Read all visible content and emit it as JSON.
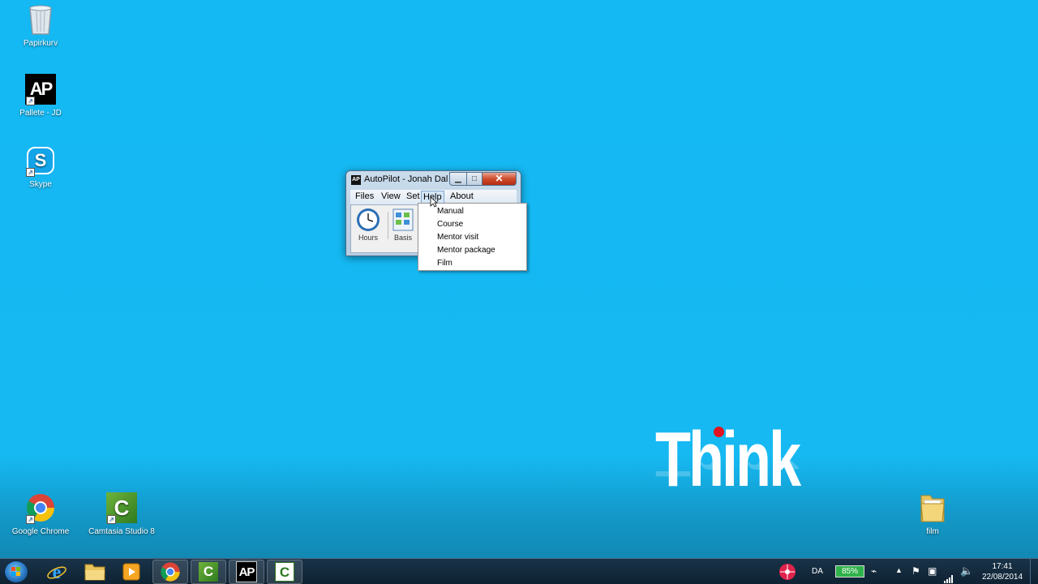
{
  "desktop": {
    "icons": [
      {
        "label": "Papirkurv"
      },
      {
        "label": "Pallete - JD"
      },
      {
        "label": "Skype"
      },
      {
        "label": "Google Chrome"
      },
      {
        "label": "Camtasia Studio 8"
      },
      {
        "label": "film"
      }
    ],
    "wallpaper_text": "Think"
  },
  "window": {
    "logo_text": "AP",
    "title": "AutoPilot - Jonah Dal...",
    "menu": [
      "Files",
      "View",
      "Set",
      "Help",
      "About"
    ],
    "active_menu": "Help",
    "tools": [
      {
        "label": "Hours",
        "icon": "clock-icon"
      },
      {
        "label": "Basis",
        "icon": "grid-icon"
      }
    ]
  },
  "help_menu": {
    "items": [
      "Manual",
      "Course",
      "Mentor visit",
      "Mentor package",
      "Film"
    ]
  },
  "taskbar": {
    "apps": [
      "start",
      "internet-explorer",
      "explorer",
      "media-player",
      "chrome",
      "camtasia",
      "autopilot",
      "camtasia-recorder"
    ],
    "language": "DA",
    "battery": "85%",
    "time": "17:41",
    "date": "22/08/2014"
  },
  "colors": {
    "desktop": "#16b9f2",
    "think_dot": "#e1141f",
    "close_button": "#cf4b2c"
  }
}
